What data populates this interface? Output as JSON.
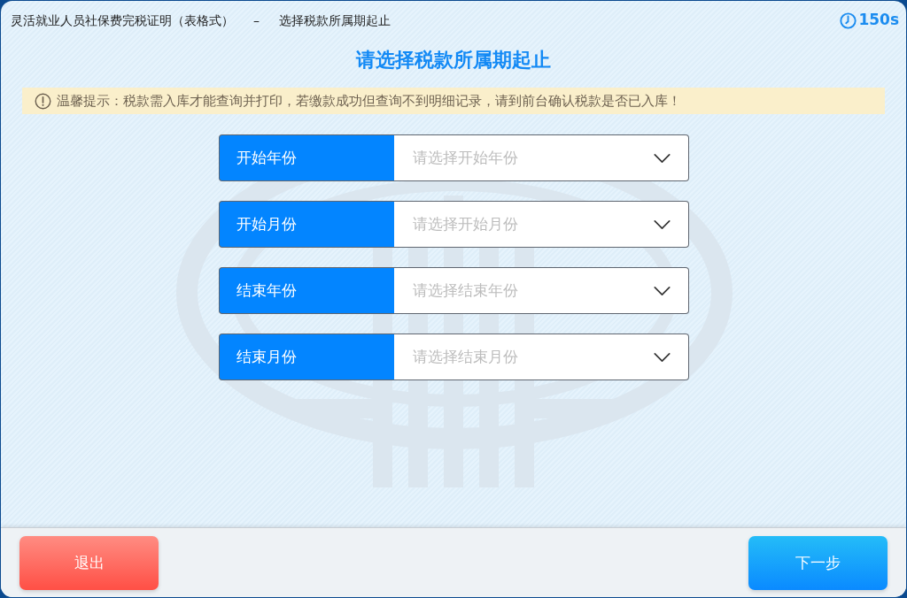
{
  "header": {
    "title": "灵活就业人员社保费完税证明（表格式）",
    "separator": "–",
    "subtitle": "选择税款所属期起止",
    "countdown": "150s"
  },
  "heading": "请选择税款所属期起止",
  "notice": {
    "text": "温馨提示：税款需入库才能查询并打印，若缴款成功但查询不到明细记录，请到前台确认税款是否已入库！"
  },
  "selects": [
    {
      "label": "开始年份",
      "placeholder": "请选择开始年份"
    },
    {
      "label": "开始月份",
      "placeholder": "请选择开始月份"
    },
    {
      "label": "结束年份",
      "placeholder": "请选择结束年份"
    },
    {
      "label": "结束月份",
      "placeholder": "请选择结束月份"
    }
  ],
  "footer": {
    "buttons": [
      {
        "label": "退出",
        "kind": "exit"
      },
      {
        "label": "下一步",
        "kind": "next"
      }
    ]
  }
}
